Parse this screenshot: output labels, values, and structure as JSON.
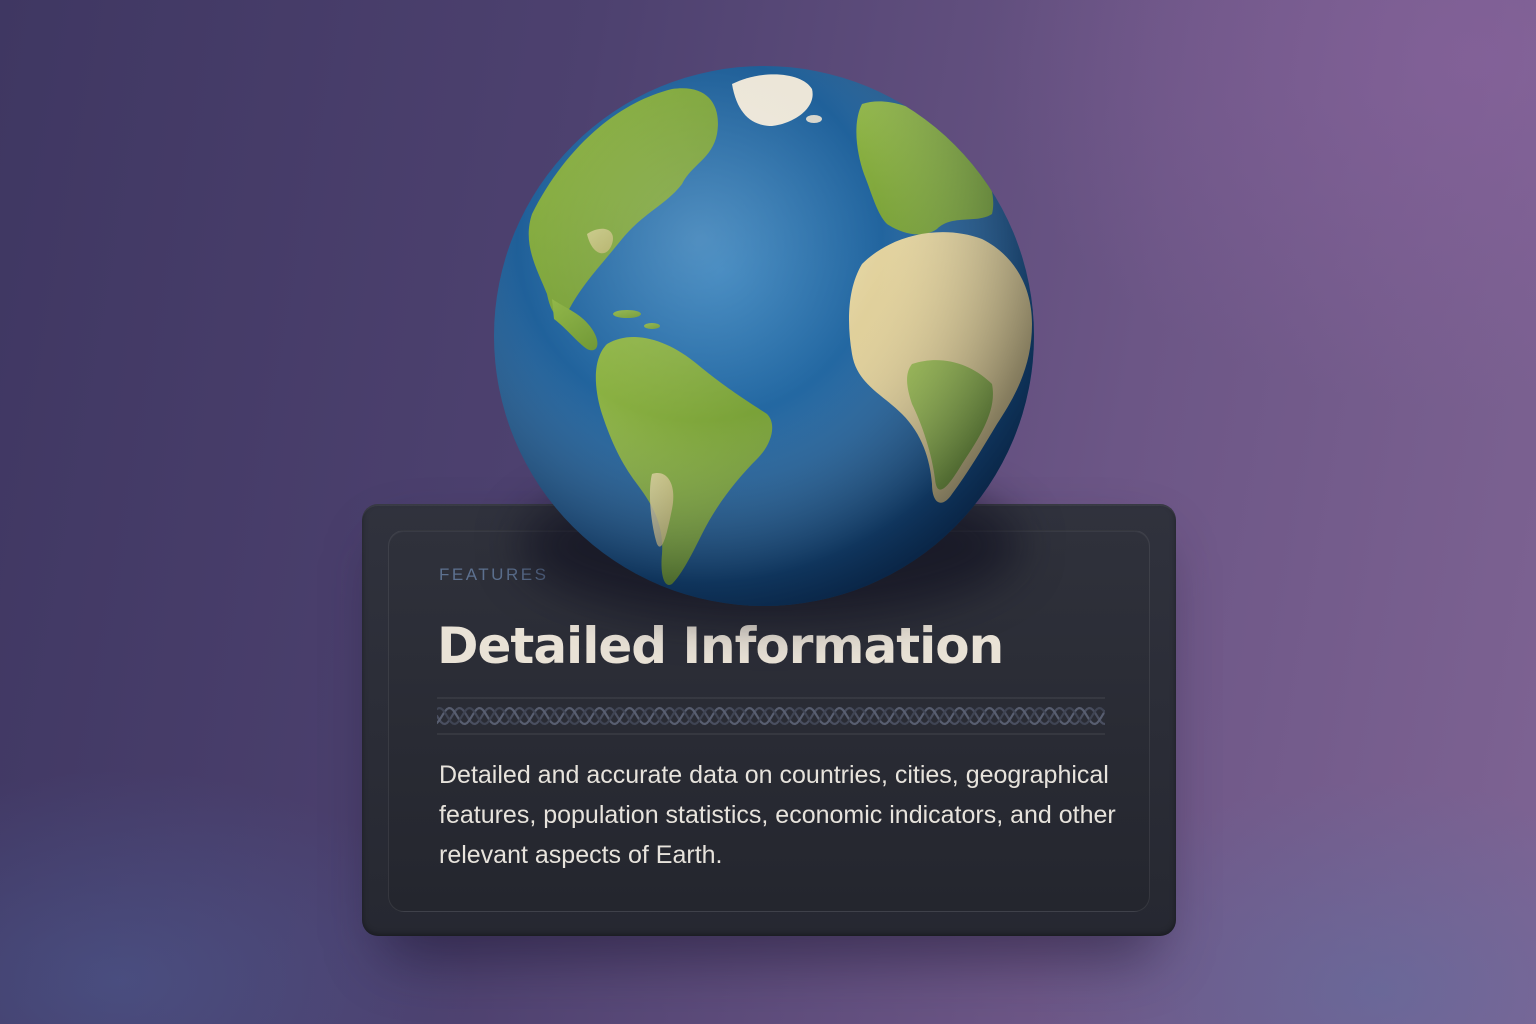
{
  "card": {
    "eyebrow": "FEATURES",
    "title": "Detailed Information",
    "description": "Detailed and accurate data on countries, cities, geographical features, population statistics, economic indicators, and other relevant aspects of Earth."
  },
  "colors": {
    "background_start": "#3f3762",
    "background_end": "#7e6393",
    "card": "#2a2c35",
    "eyebrow": "#5d7190",
    "title": "#e9e2d6",
    "body": "#e7e3dc",
    "ocean": "#1f5f98",
    "land": "#7fa53a",
    "desert": "#d9c88e"
  },
  "icons": {
    "globe": "earth-globe-illustration",
    "divider": "braided-rope-ornament"
  }
}
